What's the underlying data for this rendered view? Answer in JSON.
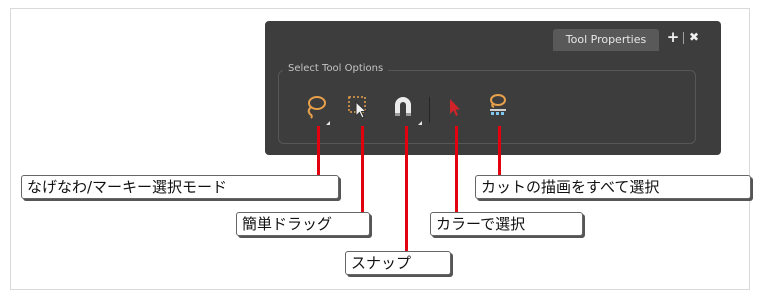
{
  "panel": {
    "tab_label": "Tool Properties",
    "add_glyph": "+",
    "close_glyph": "✖",
    "group_label": "Select Tool Options"
  },
  "tools": [
    {
      "name": "lasso-marquee-mode",
      "icon": "lasso-icon",
      "color": "#e8a04a",
      "has_submenu": true
    },
    {
      "name": "simplified-drag",
      "icon": "marquee-drag-icon",
      "color": "#e8a04a",
      "has_submenu": false
    },
    {
      "name": "snap",
      "icon": "magnet-icon",
      "color": "#e8e8e8",
      "has_submenu": true
    },
    {
      "name": "select-by-color",
      "icon": "red-arrow-icon",
      "color": "#d2232a",
      "has_submenu": false
    },
    {
      "name": "select-all-strokes",
      "icon": "lasso-dots-icon",
      "color": "#e8a04a",
      "has_submenu": false
    }
  ],
  "callouts": {
    "lasso_marquee": "なげなわ/マーキー選択モード",
    "simple_drag": "簡単ドラッグ",
    "snap": "スナップ",
    "select_by_color": "カラーで選択",
    "select_all_strokes": "カットの描画をすべて選択"
  },
  "colors": {
    "panel_bg": "#3d3d3d",
    "tab_bg": "#595959",
    "callout_line": "#e3000f",
    "accent_orange": "#e8a04a"
  }
}
